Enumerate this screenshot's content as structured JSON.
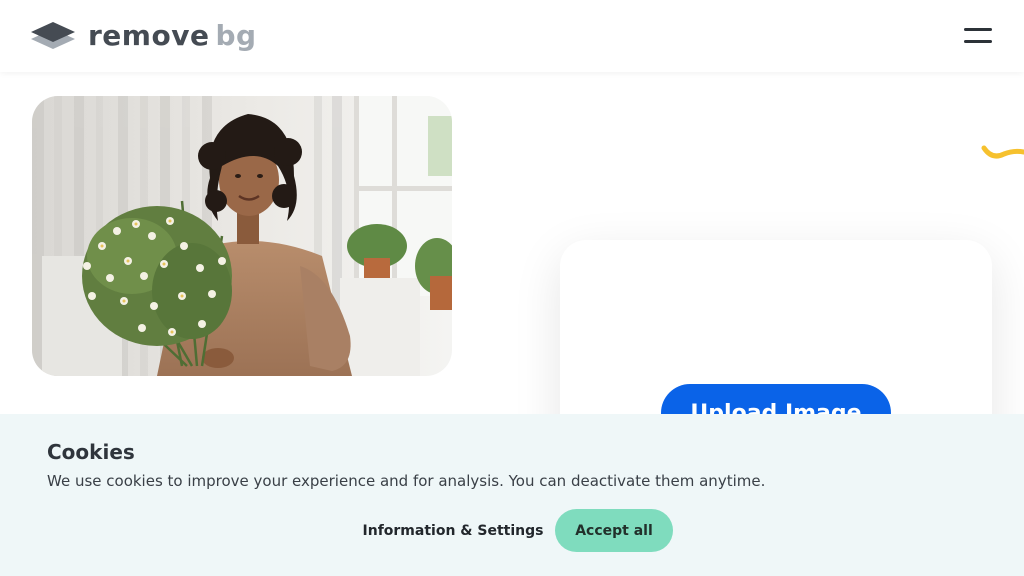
{
  "header": {
    "logo": {
      "word1": "remove",
      "word2": "bg",
      "icon": "layers-logo-icon"
    },
    "menu": {
      "icon": "hamburger-menu-icon"
    }
  },
  "hero": {
    "image": {
      "icon": "woman-with-flowers-photo"
    }
  },
  "upload": {
    "button_label": "Upload Image"
  },
  "cookie_banner": {
    "title": "Cookies",
    "text": "We use cookies to improve your experience and for analysis. You can deactivate them anytime.",
    "settings_label": "Information & Settings",
    "accept_label": "Accept all"
  },
  "colors": {
    "brand_blue": "#0a63e8",
    "accept_green": "#7fdcbe",
    "banner_bg": "#eff7f8",
    "logo_dark": "#454b53",
    "logo_light": "#a4abb3",
    "accent_yellow": "#f6c12e"
  }
}
